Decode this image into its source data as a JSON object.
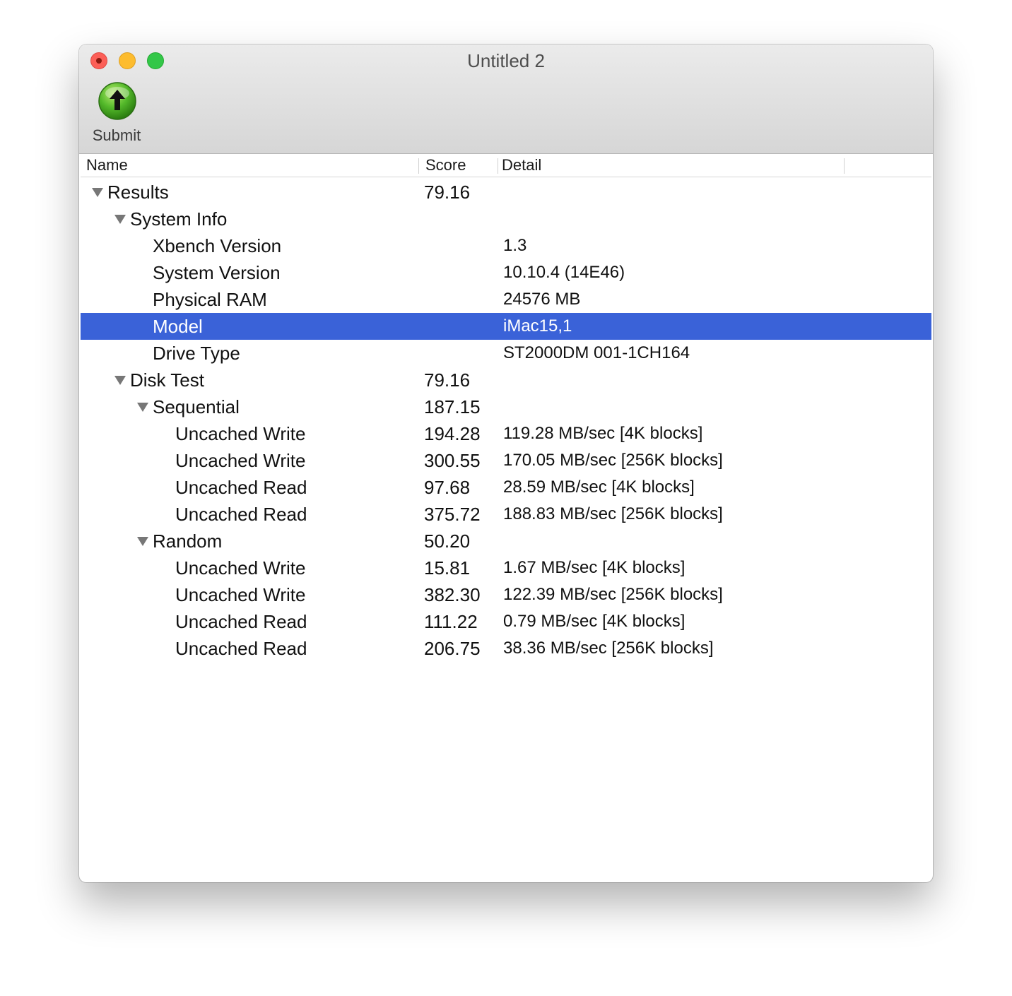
{
  "window": {
    "title": "Untitled 2"
  },
  "toolbar": {
    "submit_label": "Submit"
  },
  "columns": {
    "name": "Name",
    "score": "Score",
    "detail": "Detail"
  },
  "rows": [
    {
      "name": "Results",
      "score": "79.16",
      "detail": ""
    },
    {
      "name": "System Info",
      "score": "",
      "detail": ""
    },
    {
      "name": "Xbench Version",
      "score": "",
      "detail": "1.3"
    },
    {
      "name": "System Version",
      "score": "",
      "detail": "10.10.4 (14E46)"
    },
    {
      "name": "Physical RAM",
      "score": "",
      "detail": "24576 MB"
    },
    {
      "name": "Model",
      "score": "",
      "detail": "iMac15,1"
    },
    {
      "name": "Drive Type",
      "score": "",
      "detail": "ST2000DM 001-1CH164"
    },
    {
      "name": "Disk Test",
      "score": "79.16",
      "detail": ""
    },
    {
      "name": "Sequential",
      "score": "187.15",
      "detail": ""
    },
    {
      "name": "Uncached Write",
      "score": "194.28",
      "detail": "119.28 MB/sec [4K blocks]"
    },
    {
      "name": "Uncached Write",
      "score": "300.55",
      "detail": "170.05 MB/sec [256K blocks]"
    },
    {
      "name": "Uncached Read",
      "score": "97.68",
      "detail": "28.59 MB/sec [4K blocks]"
    },
    {
      "name": "Uncached Read",
      "score": "375.72",
      "detail": "188.83 MB/sec [256K blocks]"
    },
    {
      "name": "Random",
      "score": "50.20",
      "detail": ""
    },
    {
      "name": "Uncached Write",
      "score": "15.81",
      "detail": "1.67 MB/sec [4K blocks]"
    },
    {
      "name": "Uncached Write",
      "score": "382.30",
      "detail": "122.39 MB/sec [256K blocks]"
    },
    {
      "name": "Uncached Read",
      "score": "111.22",
      "detail": "0.79 MB/sec [4K blocks]"
    },
    {
      "name": "Uncached Read",
      "score": "206.75",
      "detail": "38.36 MB/sec [256K blocks]"
    }
  ],
  "colors": {
    "selection": "#3a62d8",
    "close": "#fc5f57",
    "minimize": "#fdbc2e",
    "maximize": "#33c748",
    "submit_icon": "#3ea21c"
  },
  "icons": {
    "submit": "green-up-arrow-icon",
    "disclosure": "disclosure-triangle-icon"
  }
}
